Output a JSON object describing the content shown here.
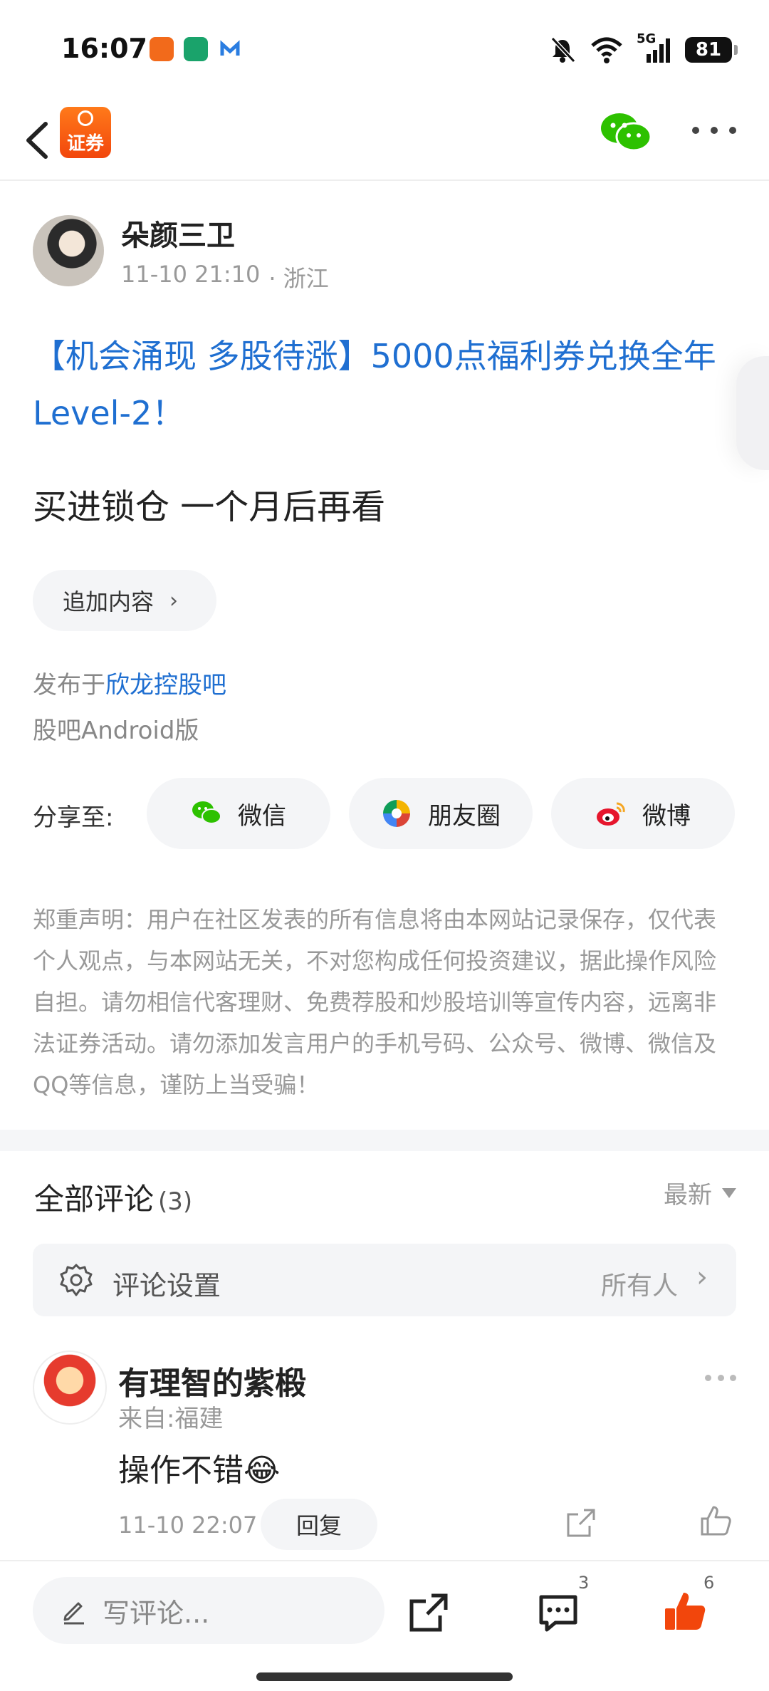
{
  "status_bar": {
    "time": "16:07",
    "network": "5G",
    "battery": "81",
    "app_icons": [
      "securities-app-icon",
      "home-app-icon",
      "mail-app-icon"
    ]
  },
  "nav": {
    "logo_text": "证券",
    "accent": "#f2460c"
  },
  "author": {
    "name": "朵颜三卫",
    "datetime": "11-10 21:10",
    "location": "· 浙江"
  },
  "post": {
    "title": "【机会涌现 多股待涨】5000点福利券兑换全年Level-2！",
    "body": "买进锁仓 一个月后再看",
    "append_label": "追加内容",
    "published_prefix": "发布于",
    "published_bar": "欣龙控股吧",
    "platform": "股吧Android版",
    "link_color": "#1f6fd1"
  },
  "share": {
    "label": "分享至:",
    "buttons": [
      {
        "label": "微信",
        "icon": "wechat-icon"
      },
      {
        "label": "朋友圈",
        "icon": "moments-icon"
      },
      {
        "label": "微博",
        "icon": "weibo-icon"
      }
    ]
  },
  "disclaimer": "郑重声明：用户在社区发表的所有信息将由本网站记录保存，仅代表个人观点，与本网站无关，不对您构成任何投资建议，据此操作风险自担。请勿相信代客理财、免费荐股和炒股培训等宣传内容，远离非法证券活动。请勿添加发言用户的手机号码、公众号、微博、微信及QQ等信息，谨防上当受骗！",
  "comments": {
    "title": "全部评论",
    "count": "(3)",
    "sort": "最新",
    "settings_label": "评论设置",
    "settings_value": "所有人",
    "items": [
      {
        "name": "有理智的紫椴",
        "location": "来自:福建",
        "text": "操作不错😂",
        "time": "11-10 22:07",
        "reply_label": "回复"
      }
    ]
  },
  "bottom_bar": {
    "placeholder": "写评论...",
    "comment_count": "3",
    "like_count": "6",
    "like_color": "#f2460c"
  }
}
